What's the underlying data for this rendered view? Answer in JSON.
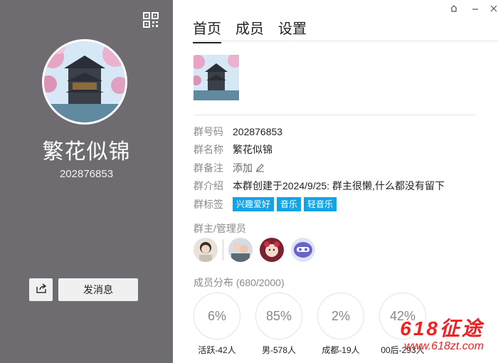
{
  "left": {
    "group_name": "繁花似锦",
    "group_number": "202876853",
    "send_message_label": "发消息",
    "icons": {
      "qr": "qr-code-icon",
      "share": "share-icon"
    }
  },
  "tabs": [
    {
      "label": "首页",
      "active": true
    },
    {
      "label": "成员",
      "active": false
    },
    {
      "label": "设置",
      "active": false
    }
  ],
  "info": {
    "number": {
      "label": "群号码",
      "value": "202876853"
    },
    "name": {
      "label": "群名称",
      "value": "繁花似锦"
    },
    "remark": {
      "label": "群备注",
      "value": "添加"
    },
    "intro": {
      "label": "群介绍",
      "value": "本群创建于2024/9/25:  群主很懒,什么都没有留下"
    },
    "tags": {
      "label": "群标签",
      "items": [
        "兴趣爱好",
        "音乐",
        "轻音乐"
      ]
    }
  },
  "admins_title": "群主/管理员",
  "distribution": {
    "title": "成员分布",
    "count": "(680/2000)",
    "stats": [
      {
        "percent": "6%",
        "label": "活跃-42人"
      },
      {
        "percent": "85%",
        "label": "男-578人"
      },
      {
        "percent": "2%",
        "label": "成都-19人"
      },
      {
        "percent": "42%",
        "label": "00后-293人"
      }
    ]
  },
  "watermark": {
    "big": "618征途",
    "small": "www.618zt.com"
  },
  "colors": {
    "left_bg": "#6e6b71",
    "tag_bg": "#13a4e8",
    "watermark": "#e22222"
  }
}
